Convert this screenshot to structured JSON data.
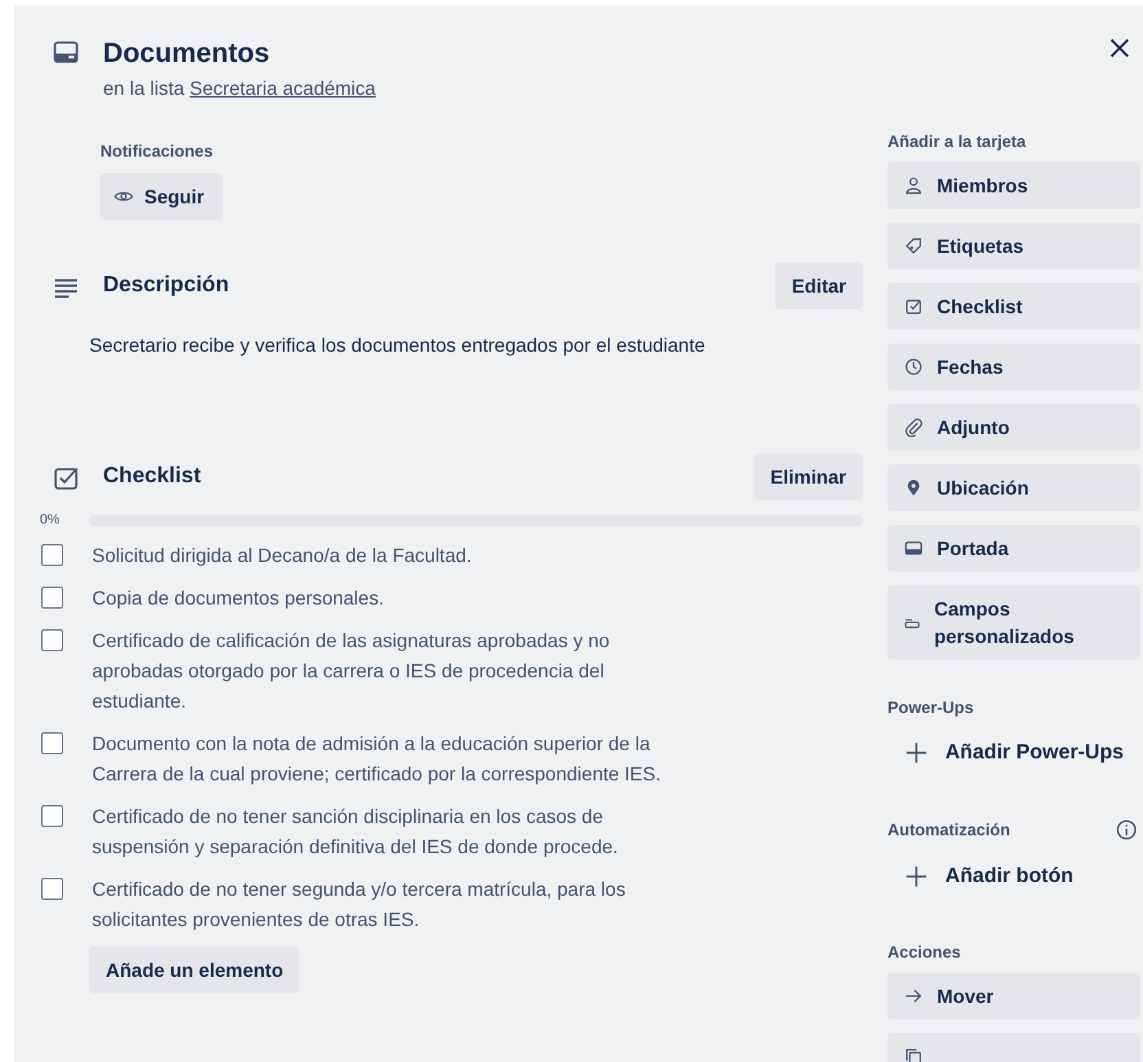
{
  "card": {
    "title": "Documentos",
    "list_prefix": "en la lista",
    "list_link": "Secretaria académica"
  },
  "notifications": {
    "label": "Notificaciones",
    "button": "Seguir"
  },
  "description": {
    "heading": "Descripción",
    "edit_button": "Editar",
    "text": "Secretario recibe y verifica los documentos entregados por el estudiante"
  },
  "checklist": {
    "heading": "Checklist",
    "delete_button": "Eliminar",
    "percent": "0%",
    "level": 0,
    "items": [
      {
        "text": "Solicitud dirigida al Decano/a de la Facultad.",
        "checked": false
      },
      {
        "text": "Copia de documentos personales.",
        "checked": false
      },
      {
        "text": "Certificado de calificación de las asignaturas aprobadas y no aprobadas otorgado por la carrera o IES de procedencia del estudiante.",
        "checked": false
      },
      {
        "text": "Documento con la nota de admisión a la educación superior de la Carrera de la cual proviene; certificado por la correspondiente IES.",
        "checked": false
      },
      {
        "text": "Certificado de no tener sanción disciplinaria en los casos de suspensión y separación definitiva del IES de donde procede.",
        "checked": false
      },
      {
        "text": "Certificado de no tener segunda y/o tercera matrícula, para los solicitantes provenientes de otras IES.",
        "checked": false
      }
    ],
    "add_button": "Añade un elemento"
  },
  "sidebar": {
    "sections": [
      {
        "heading": "Añadir a la tarjeta",
        "buttons": [
          {
            "kind": "action",
            "label": "Miembros"
          },
          {
            "kind": "action",
            "label": "Etiquetas"
          },
          {
            "kind": "action",
            "label": "Checklist"
          },
          {
            "kind": "action",
            "label": "Fechas"
          },
          {
            "kind": "action",
            "label": "Adjunto"
          },
          {
            "kind": "action",
            "label": "Ubicación"
          },
          {
            "kind": "action",
            "label": "Portada"
          },
          {
            "kind": "action",
            "label": "Campos personalizados"
          }
        ]
      },
      {
        "heading": "Power-Ups",
        "buttons": [
          {
            "kind": "add",
            "label": "Añadir Power-Ups"
          }
        ]
      },
      {
        "heading": "Automatización",
        "buttons": [
          {
            "kind": "add",
            "label": "Añadir botón"
          }
        ]
      },
      {
        "heading": "Acciones",
        "buttons": [
          {
            "kind": "action",
            "label": "Mover"
          },
          {
            "kind": "action"
          }
        ]
      }
    ]
  }
}
